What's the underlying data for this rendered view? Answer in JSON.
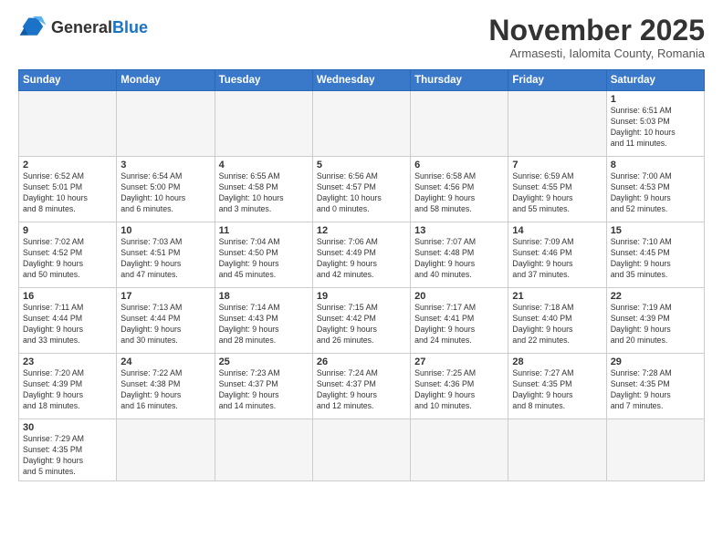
{
  "logo": {
    "text_general": "General",
    "text_blue": "Blue"
  },
  "header": {
    "month_title": "November 2025",
    "subtitle": "Armasesti, Ialomita County, Romania"
  },
  "weekdays": [
    "Sunday",
    "Monday",
    "Tuesday",
    "Wednesday",
    "Thursday",
    "Friday",
    "Saturday"
  ],
  "weeks": [
    [
      {
        "day": "",
        "info": ""
      },
      {
        "day": "",
        "info": ""
      },
      {
        "day": "",
        "info": ""
      },
      {
        "day": "",
        "info": ""
      },
      {
        "day": "",
        "info": ""
      },
      {
        "day": "",
        "info": ""
      },
      {
        "day": "1",
        "info": "Sunrise: 6:51 AM\nSunset: 5:03 PM\nDaylight: 10 hours\nand 11 minutes."
      }
    ],
    [
      {
        "day": "2",
        "info": "Sunrise: 6:52 AM\nSunset: 5:01 PM\nDaylight: 10 hours\nand 8 minutes."
      },
      {
        "day": "3",
        "info": "Sunrise: 6:54 AM\nSunset: 5:00 PM\nDaylight: 10 hours\nand 6 minutes."
      },
      {
        "day": "4",
        "info": "Sunrise: 6:55 AM\nSunset: 4:58 PM\nDaylight: 10 hours\nand 3 minutes."
      },
      {
        "day": "5",
        "info": "Sunrise: 6:56 AM\nSunset: 4:57 PM\nDaylight: 10 hours\nand 0 minutes."
      },
      {
        "day": "6",
        "info": "Sunrise: 6:58 AM\nSunset: 4:56 PM\nDaylight: 9 hours\nand 58 minutes."
      },
      {
        "day": "7",
        "info": "Sunrise: 6:59 AM\nSunset: 4:55 PM\nDaylight: 9 hours\nand 55 minutes."
      },
      {
        "day": "8",
        "info": "Sunrise: 7:00 AM\nSunset: 4:53 PM\nDaylight: 9 hours\nand 52 minutes."
      }
    ],
    [
      {
        "day": "9",
        "info": "Sunrise: 7:02 AM\nSunset: 4:52 PM\nDaylight: 9 hours\nand 50 minutes."
      },
      {
        "day": "10",
        "info": "Sunrise: 7:03 AM\nSunset: 4:51 PM\nDaylight: 9 hours\nand 47 minutes."
      },
      {
        "day": "11",
        "info": "Sunrise: 7:04 AM\nSunset: 4:50 PM\nDaylight: 9 hours\nand 45 minutes."
      },
      {
        "day": "12",
        "info": "Sunrise: 7:06 AM\nSunset: 4:49 PM\nDaylight: 9 hours\nand 42 minutes."
      },
      {
        "day": "13",
        "info": "Sunrise: 7:07 AM\nSunset: 4:48 PM\nDaylight: 9 hours\nand 40 minutes."
      },
      {
        "day": "14",
        "info": "Sunrise: 7:09 AM\nSunset: 4:46 PM\nDaylight: 9 hours\nand 37 minutes."
      },
      {
        "day": "15",
        "info": "Sunrise: 7:10 AM\nSunset: 4:45 PM\nDaylight: 9 hours\nand 35 minutes."
      }
    ],
    [
      {
        "day": "16",
        "info": "Sunrise: 7:11 AM\nSunset: 4:44 PM\nDaylight: 9 hours\nand 33 minutes."
      },
      {
        "day": "17",
        "info": "Sunrise: 7:13 AM\nSunset: 4:44 PM\nDaylight: 9 hours\nand 30 minutes."
      },
      {
        "day": "18",
        "info": "Sunrise: 7:14 AM\nSunset: 4:43 PM\nDaylight: 9 hours\nand 28 minutes."
      },
      {
        "day": "19",
        "info": "Sunrise: 7:15 AM\nSunset: 4:42 PM\nDaylight: 9 hours\nand 26 minutes."
      },
      {
        "day": "20",
        "info": "Sunrise: 7:17 AM\nSunset: 4:41 PM\nDaylight: 9 hours\nand 24 minutes."
      },
      {
        "day": "21",
        "info": "Sunrise: 7:18 AM\nSunset: 4:40 PM\nDaylight: 9 hours\nand 22 minutes."
      },
      {
        "day": "22",
        "info": "Sunrise: 7:19 AM\nSunset: 4:39 PM\nDaylight: 9 hours\nand 20 minutes."
      }
    ],
    [
      {
        "day": "23",
        "info": "Sunrise: 7:20 AM\nSunset: 4:39 PM\nDaylight: 9 hours\nand 18 minutes."
      },
      {
        "day": "24",
        "info": "Sunrise: 7:22 AM\nSunset: 4:38 PM\nDaylight: 9 hours\nand 16 minutes."
      },
      {
        "day": "25",
        "info": "Sunrise: 7:23 AM\nSunset: 4:37 PM\nDaylight: 9 hours\nand 14 minutes."
      },
      {
        "day": "26",
        "info": "Sunrise: 7:24 AM\nSunset: 4:37 PM\nDaylight: 9 hours\nand 12 minutes."
      },
      {
        "day": "27",
        "info": "Sunrise: 7:25 AM\nSunset: 4:36 PM\nDaylight: 9 hours\nand 10 minutes."
      },
      {
        "day": "28",
        "info": "Sunrise: 7:27 AM\nSunset: 4:35 PM\nDaylight: 9 hours\nand 8 minutes."
      },
      {
        "day": "29",
        "info": "Sunrise: 7:28 AM\nSunset: 4:35 PM\nDaylight: 9 hours\nand 7 minutes."
      }
    ],
    [
      {
        "day": "30",
        "info": "Sunrise: 7:29 AM\nSunset: 4:35 PM\nDaylight: 9 hours\nand 5 minutes."
      },
      {
        "day": "",
        "info": ""
      },
      {
        "day": "",
        "info": ""
      },
      {
        "day": "",
        "info": ""
      },
      {
        "day": "",
        "info": ""
      },
      {
        "day": "",
        "info": ""
      },
      {
        "day": "",
        "info": ""
      }
    ]
  ]
}
